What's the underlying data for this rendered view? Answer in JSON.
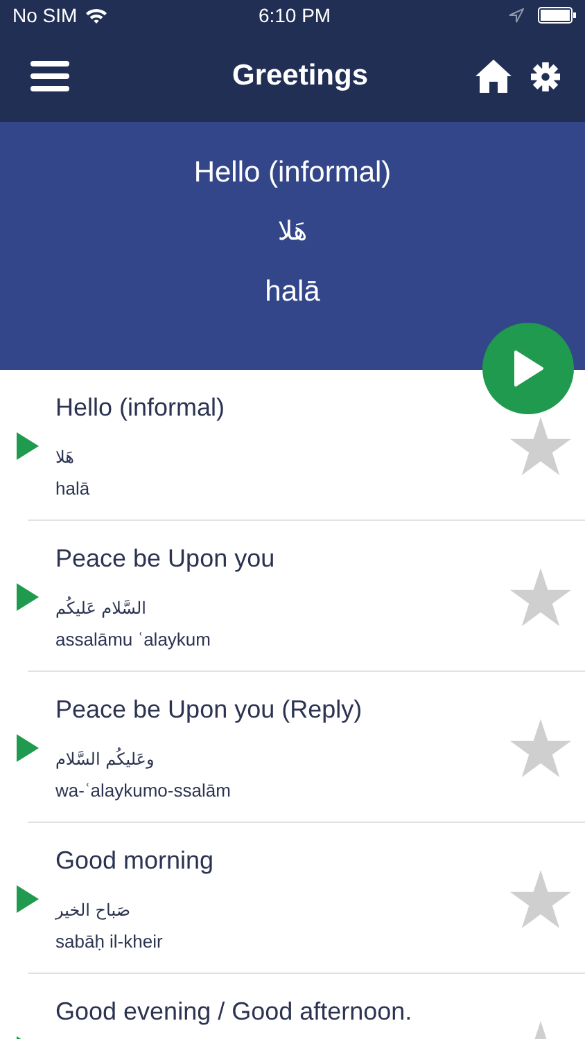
{
  "status_bar": {
    "carrier": "No SIM",
    "time": "6:10 PM"
  },
  "nav_bar": {
    "title": "Greetings"
  },
  "header": {
    "english": "Hello (informal)",
    "arabic": "هَلا",
    "transliteration": "halā"
  },
  "phrases": [
    {
      "english": "Hello (informal)",
      "arabic": "هَلا",
      "transliteration": "halā",
      "favorite": false
    },
    {
      "english": "Peace be Upon you",
      "arabic": "السَّلام عَليكُم",
      "transliteration": "assalāmu ʿalaykum",
      "favorite": false
    },
    {
      "english": "Peace be Upon you (Reply)",
      "arabic": "وعَليكُم السَّلام",
      "transliteration": "wa-ʿalaykumo-ssalām",
      "favorite": false
    },
    {
      "english": "Good morning",
      "arabic": "صَباح الخير",
      "transliteration": "sabāḥ il-kheir",
      "favorite": false
    },
    {
      "english": "Good evening / Good afternoon.",
      "favorite": false
    }
  ]
}
